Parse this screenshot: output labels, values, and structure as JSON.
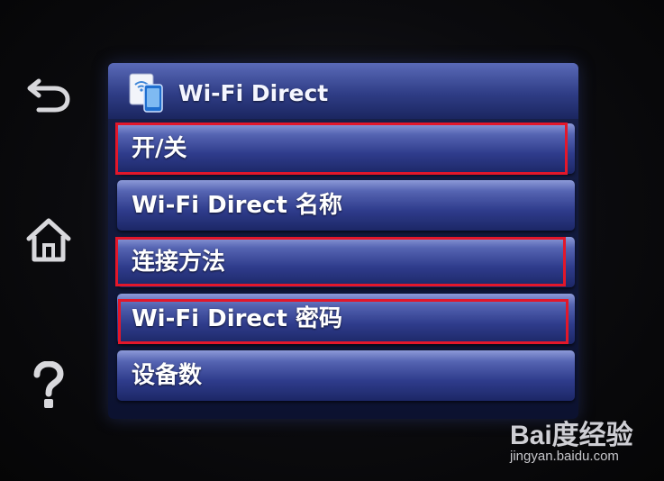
{
  "sidebar": {
    "buttons": [
      {
        "name": "back",
        "icon": "back-arrow-icon"
      },
      {
        "name": "home",
        "icon": "home-icon"
      },
      {
        "name": "help",
        "icon": "help-icon"
      }
    ]
  },
  "screen": {
    "title": "Wi-Fi Direct",
    "title_icon": "wifi-direct-phone-icon",
    "items": [
      {
        "label": "开/关",
        "highlighted": true
      },
      {
        "label": "Wi-Fi Direct 名称",
        "highlighted": false
      },
      {
        "label": "连接方法",
        "highlighted": true
      },
      {
        "label": "Wi-Fi Direct 密码",
        "highlighted": true
      },
      {
        "label": "设备数",
        "highlighted": false
      }
    ]
  },
  "watermark": {
    "brand": "Bai度经验",
    "url": "jingyan.baidu.com"
  },
  "colors": {
    "highlight_frame": "#e3172a",
    "item_top": "#8d9ad8",
    "item_bottom": "#1c2766",
    "title_bar": "#2f3d86"
  }
}
